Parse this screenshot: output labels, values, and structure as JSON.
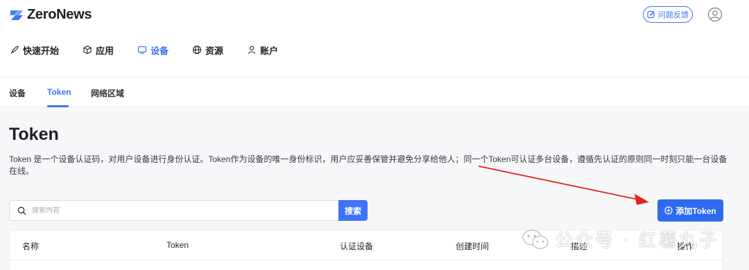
{
  "brand": {
    "name": "ZeroNews",
    "accent": "#3d73f5"
  },
  "header": {
    "feedback_label": "问题反馈",
    "feedback_icon": "edit-square-icon",
    "avatar_icon": "user-circle-icon"
  },
  "main_nav": [
    {
      "label": "快速开始",
      "icon": "rocket-icon"
    },
    {
      "label": "应用",
      "icon": "cube-icon"
    },
    {
      "label": "设备",
      "icon": "monitor-icon",
      "active": true
    },
    {
      "label": "资源",
      "icon": "globe-icon"
    },
    {
      "label": "账户",
      "icon": "user-icon"
    }
  ],
  "sub_nav": [
    {
      "label": "设备"
    },
    {
      "label": "Token",
      "active": true
    },
    {
      "label": "网络区域"
    }
  ],
  "page": {
    "title": "Token",
    "description": "Token 是一个设备认证码，对用户设备进行身份认证。Token作为设备的唯一身份标识，用户应妥善保管并避免分享给他人；同一个Token可认证多台设备，遵循先认证的原则同一时刻只能一台设备在线。"
  },
  "search": {
    "placeholder": "搜索内容",
    "value": "",
    "button_label": "搜索"
  },
  "add_button": {
    "label": "添加Token",
    "icon": "plus-circle-icon"
  },
  "table": {
    "columns": [
      "名称",
      "Token",
      "认证设备",
      "创建时间",
      "描述",
      "操作"
    ]
  },
  "watermark": {
    "text": "公众号 · 红薯丸子"
  }
}
